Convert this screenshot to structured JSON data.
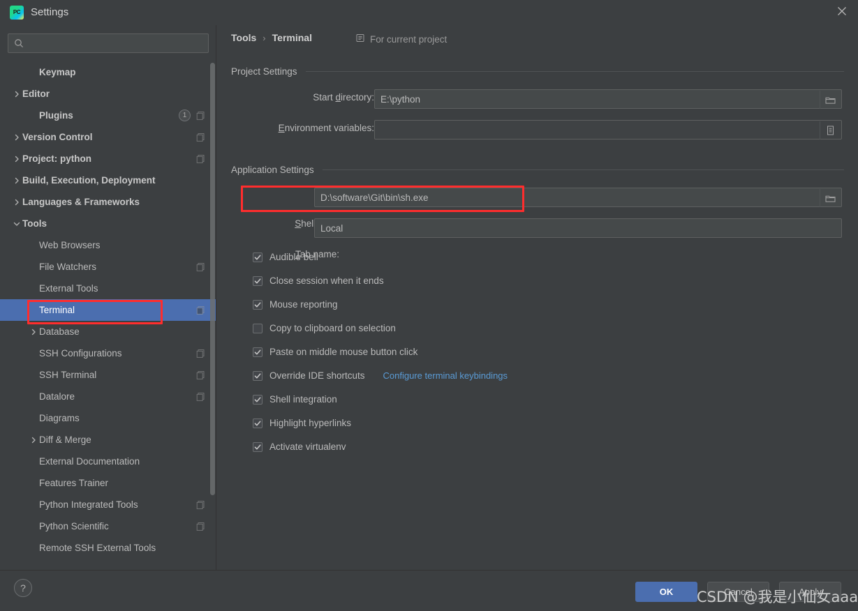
{
  "window": {
    "title": "Settings",
    "logo_text": "PC",
    "close_icon": "close-icon"
  },
  "sidebar": {
    "search": {
      "value": "",
      "placeholder": ""
    },
    "items": [
      {
        "label": "Keymap",
        "indent": 1,
        "arrow": "none",
        "bold": true,
        "badge": null,
        "copy": false
      },
      {
        "label": "Editor",
        "indent": 0,
        "arrow": "right",
        "bold": true,
        "badge": null,
        "copy": false
      },
      {
        "label": "Plugins",
        "indent": 1,
        "arrow": "none",
        "bold": true,
        "badge": "1",
        "copy": true
      },
      {
        "label": "Version Control",
        "indent": 0,
        "arrow": "right",
        "bold": true,
        "badge": null,
        "copy": true
      },
      {
        "label": "Project: python",
        "indent": 0,
        "arrow": "right",
        "bold": true,
        "badge": null,
        "copy": true
      },
      {
        "label": "Build, Execution, Deployment",
        "indent": 0,
        "arrow": "right",
        "bold": true,
        "badge": null,
        "copy": false
      },
      {
        "label": "Languages & Frameworks",
        "indent": 0,
        "arrow": "right",
        "bold": true,
        "badge": null,
        "copy": false
      },
      {
        "label": "Tools",
        "indent": 0,
        "arrow": "down",
        "bold": true,
        "badge": null,
        "copy": false
      },
      {
        "label": "Web Browsers",
        "indent": 1,
        "arrow": "none",
        "bold": false,
        "badge": null,
        "copy": false
      },
      {
        "label": "File Watchers",
        "indent": 1,
        "arrow": "none",
        "bold": false,
        "badge": null,
        "copy": true
      },
      {
        "label": "External Tools",
        "indent": 1,
        "arrow": "none",
        "bold": false,
        "badge": null,
        "copy": false
      },
      {
        "label": "Terminal",
        "indent": 1,
        "arrow": "none",
        "bold": false,
        "badge": null,
        "copy": true,
        "selected": true
      },
      {
        "label": "Database",
        "indent": 1,
        "arrow": "right",
        "bold": false,
        "badge": null,
        "copy": false
      },
      {
        "label": "SSH Configurations",
        "indent": 1,
        "arrow": "none",
        "bold": false,
        "badge": null,
        "copy": true
      },
      {
        "label": "SSH Terminal",
        "indent": 1,
        "arrow": "none",
        "bold": false,
        "badge": null,
        "copy": true
      },
      {
        "label": "Datalore",
        "indent": 1,
        "arrow": "none",
        "bold": false,
        "badge": null,
        "copy": true
      },
      {
        "label": "Diagrams",
        "indent": 1,
        "arrow": "none",
        "bold": false,
        "badge": null,
        "copy": false
      },
      {
        "label": "Diff & Merge",
        "indent": 1,
        "arrow": "right",
        "bold": false,
        "badge": null,
        "copy": false
      },
      {
        "label": "External Documentation",
        "indent": 1,
        "arrow": "none",
        "bold": false,
        "badge": null,
        "copy": false
      },
      {
        "label": "Features Trainer",
        "indent": 1,
        "arrow": "none",
        "bold": false,
        "badge": null,
        "copy": false
      },
      {
        "label": "Python Integrated Tools",
        "indent": 1,
        "arrow": "none",
        "bold": false,
        "badge": null,
        "copy": true
      },
      {
        "label": "Python Scientific",
        "indent": 1,
        "arrow": "none",
        "bold": false,
        "badge": null,
        "copy": true
      },
      {
        "label": "Remote SSH External Tools",
        "indent": 1,
        "arrow": "none",
        "bold": false,
        "badge": null,
        "copy": false
      }
    ]
  },
  "main": {
    "breadcrumb": {
      "root": "Tools",
      "separator": "›",
      "leaf": "Terminal"
    },
    "for_current_project": {
      "label": "For current project",
      "icon": "project-scope-icon"
    },
    "project_settings": {
      "heading": "Project Settings",
      "start_directory": {
        "label_pre": "Start ",
        "label_mn": "d",
        "label_post": "irectory:",
        "value": "E:\\python",
        "browse_icon": "folder-icon"
      },
      "environment_variables": {
        "label_mn": "E",
        "label_post": "nvironment variables:",
        "value": "",
        "browse_icon": "variables-list-icon"
      }
    },
    "application_settings": {
      "heading": "Application Settings",
      "shell_path": {
        "label_mn": "S",
        "label_post": "hell path:",
        "value": "D:\\software\\Git\\bin\\sh.exe",
        "browse_icon": "folder-icon"
      },
      "tab_name": {
        "label_mn": "T",
        "label_post": "ab name:",
        "value": "Local"
      },
      "checkboxes": [
        {
          "label": "Audible bell",
          "checked": true
        },
        {
          "label": "Close session when it ends",
          "checked": true
        },
        {
          "label": "Mouse reporting",
          "checked": true
        },
        {
          "label": "Copy to clipboard on selection",
          "checked": false
        },
        {
          "label": "Paste on middle mouse button click",
          "checked": true
        },
        {
          "label": "Override IDE shortcuts",
          "checked": true,
          "link": "Configure terminal keybindings"
        },
        {
          "label": "Shell integration",
          "checked": true
        },
        {
          "label": "Highlight hyperlinks",
          "checked": true
        },
        {
          "label": "Activate virtualenv",
          "checked": true
        }
      ]
    }
  },
  "footer": {
    "help_label": "?",
    "ok_label": "OK",
    "cancel_label": "Cancel",
    "apply_label": "Apply"
  },
  "watermark": {
    "text": "CSDN @我是小仙女aaaa"
  },
  "colors": {
    "selection_blue": "#4b6eaf",
    "panel_bg": "#3c3f41",
    "field_bg": "#45494a",
    "link_blue": "#5a9bd5",
    "annotation_red": "#ff2d2d",
    "text": "#bbbbbb"
  }
}
